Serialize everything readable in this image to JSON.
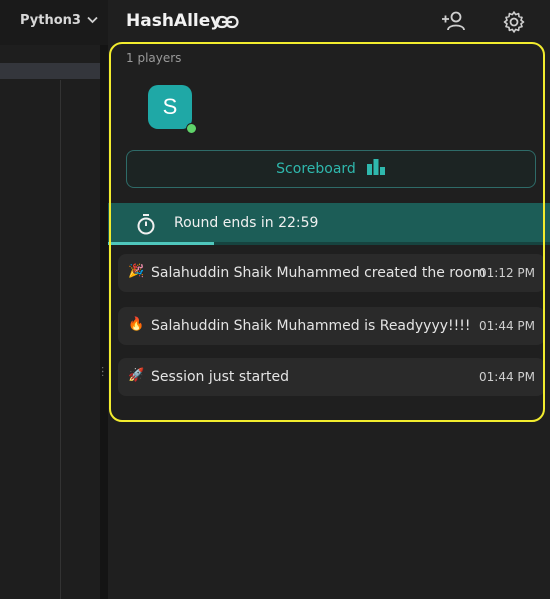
{
  "editor": {
    "language": "Python3"
  },
  "header": {
    "room_name": "HashAlley",
    "icons": [
      "link-icon",
      "add-user-icon",
      "gear-icon"
    ]
  },
  "players": {
    "count_label": "1 players",
    "list": [
      {
        "initial": "S",
        "status": "online"
      }
    ]
  },
  "scoreboard": {
    "label": "Scoreboard",
    "icon": "bar-chart-icon",
    "accent": "#2fb8ad"
  },
  "round": {
    "text": "Round ends in 22:59",
    "progress_fraction": 0.24,
    "icon": "stopwatch-icon"
  },
  "messages": [
    {
      "emoji": "🎉",
      "text": "Salahuddin Shaik Muhammed created the room",
      "time": "01:12 PM"
    },
    {
      "emoji": "🔥",
      "text": "Salahuddin Shaik Muhammed is Readyyyy!!!!",
      "time": "01:44 PM"
    },
    {
      "emoji": "🚀",
      "text": "Session just started",
      "time": "01:44 PM"
    }
  ],
  "colors": {
    "background": "#1f1f1f",
    "accent_teal": "#1fa8a6",
    "round_bar": "#1c5d57",
    "highlight_border": "#f2ec2e",
    "online": "#5fd36a"
  }
}
